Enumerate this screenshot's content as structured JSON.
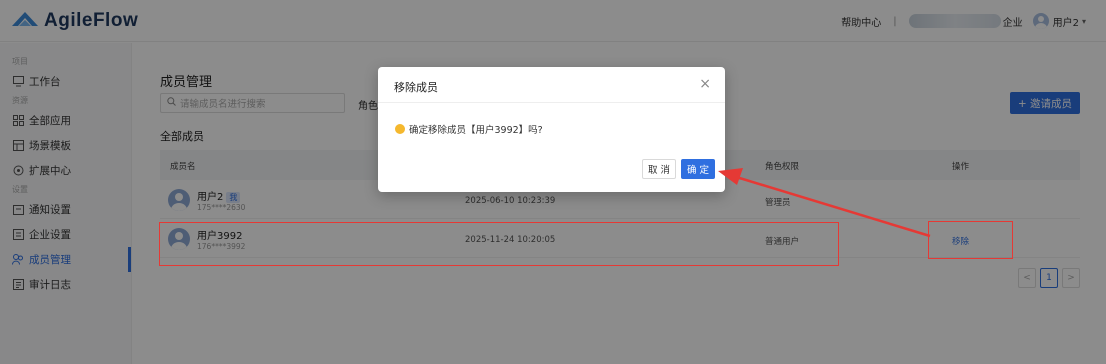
{
  "app": {
    "name": "AgileFlow"
  },
  "topbar": {
    "help": "帮助中心",
    "separator": "|",
    "org_suffix": "企业",
    "user": "用户2",
    "caret": "▾"
  },
  "sidebar": {
    "group_project": "项目",
    "group_resource": "资源",
    "group_settings": "设置",
    "items": [
      {
        "label": "工作台",
        "icon": "monitor-icon"
      },
      {
        "label": "全部应用",
        "icon": "grid-icon"
      },
      {
        "label": "场景模板",
        "icon": "template-icon"
      },
      {
        "label": "扩展中心",
        "icon": "extension-icon"
      },
      {
        "label": "通知设置",
        "icon": "notification-icon"
      },
      {
        "label": "企业设置",
        "icon": "company-icon"
      },
      {
        "label": "成员管理",
        "icon": "members-icon",
        "active": true
      },
      {
        "label": "审计日志",
        "icon": "audit-icon"
      }
    ]
  },
  "main": {
    "title": "成员管理",
    "search_placeholder": "请输成员名进行搜索",
    "role_label": "角色",
    "invite_button": "+ 邀请成员",
    "section_title": "全部成员",
    "columns": {
      "name": "成员名",
      "role": "角色权限",
      "action": "操作"
    },
    "rows": [
      {
        "name": "用户2",
        "badge": "我",
        "phone": "175****2630",
        "time": "2025-06-10 10:23:39",
        "role": "管理员",
        "action": ""
      },
      {
        "name": "用户3992",
        "badge": "",
        "phone": "176****3992",
        "time": "2025-11-24 10:20:05",
        "role": "普通用户",
        "action": "移除"
      }
    ],
    "pager": {
      "prev": "<",
      "current": "1",
      "next": ">"
    }
  },
  "modal": {
    "title": "移除成员",
    "close": "×",
    "message": "确定移除成员【用户3992】吗?",
    "cancel": "取 消",
    "ok": "确 定"
  },
  "colors": {
    "primary": "#2f6fe0",
    "annotation": "#e53935",
    "warning": "#f5b82e"
  }
}
